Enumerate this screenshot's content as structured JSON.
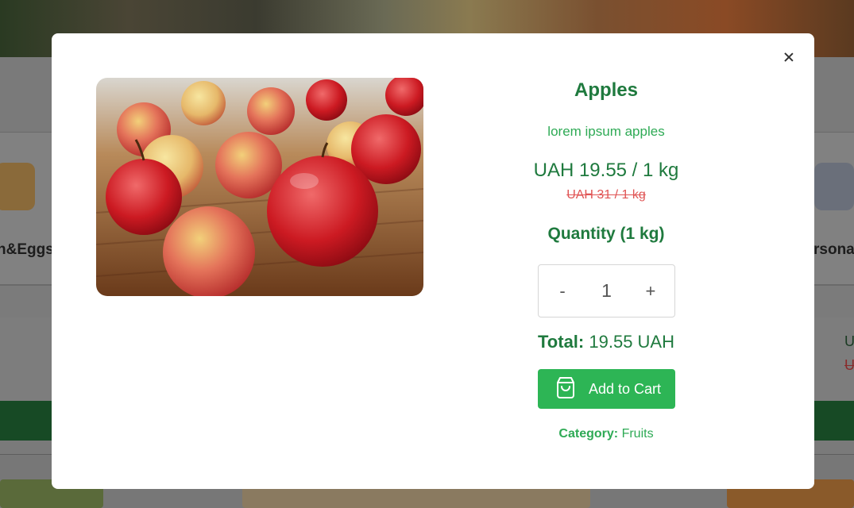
{
  "background": {
    "categories": [
      "n&Eggs",
      "rsona"
    ],
    "price_partial": "U",
    "old_price_partial": "U"
  },
  "modal": {
    "close_icon": "close-icon",
    "product": {
      "title": "Apples",
      "description": "lorem ipsum apples",
      "price": "UAH 19.55 / 1 kg",
      "old_price": "UAH 31 / 1 kg",
      "image_icon": "apples-photo"
    },
    "quantity": {
      "title": "Quantity (1 kg)",
      "decrement": "-",
      "value": "1",
      "increment": "+"
    },
    "total": {
      "label": "Total:",
      "value": "19.55 UAH"
    },
    "add_to_cart": {
      "label": "Add to Cart",
      "icon": "shopping-bag-icon"
    },
    "category": {
      "label": "Category:",
      "value": "Fruits"
    }
  },
  "colors": {
    "brand_green": "#1f7a3e",
    "accent_green": "#2db555",
    "old_price_red": "#e05555"
  }
}
